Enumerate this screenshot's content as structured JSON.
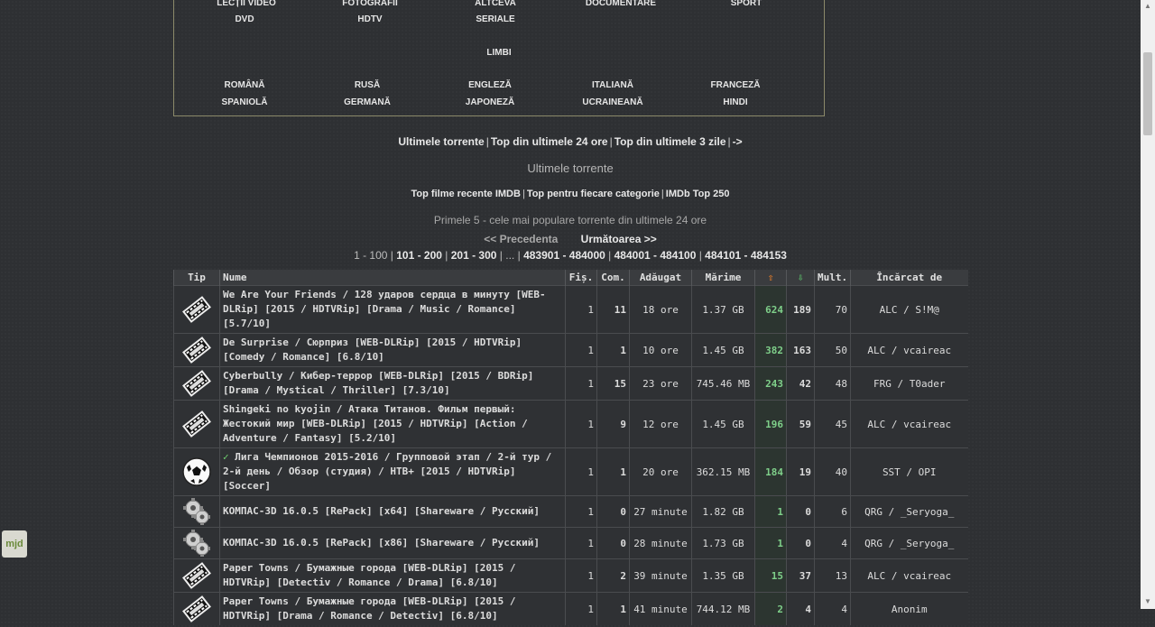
{
  "categories": {
    "row1": [
      "LECȚII VIDEO",
      "FOTOGRAFII",
      "ALTCEVA",
      "DOCUMENTARE",
      "SPORT"
    ],
    "row2": [
      "DVD",
      "HDTV",
      "SERIALE"
    ],
    "limbi_label": "LIMBI",
    "row3": [
      "ROMÂNĂ",
      "RUSĂ",
      "ENGLEZĂ",
      "ITALIANĂ",
      "FRANCEZĂ"
    ],
    "row4": [
      "SPANIOLĂ",
      "GERMANĂ",
      "JAPONEZĂ",
      "UCRAINEANĂ",
      "HINDI"
    ]
  },
  "nav": {
    "links": [
      "Ultimele torrente",
      "Top din ultimele 24 ore",
      "Top din ultimele 3 zile",
      "->"
    ]
  },
  "section_title": "Ultimele torrente",
  "imdb_nav": {
    "links": [
      "Top filme recente IMDB",
      "Top pentru fiecare categorie",
      "IMDb Top 250"
    ]
  },
  "note": "Primele 5 - cele mai populare torrente din ultimele 24 ore",
  "prev_label": "<< Precedenta",
  "next_label": "Următoarea >>",
  "pages": {
    "current": "1 - 100",
    "links": [
      "101 - 200",
      "201 - 300",
      "...",
      "483901 - 484000",
      "484001 - 484100",
      "484101 - 484153"
    ]
  },
  "table": {
    "headers": {
      "tip": "Tip",
      "name": "Nume",
      "files": "Fiș.",
      "comments": "Com.",
      "added": "Adăugat",
      "size": "Mărime",
      "seed_icon": "arrow-up-icon",
      "leech_icon": "arrow-down-icon",
      "mult": "Mult.",
      "uploader": "Încărcat de"
    },
    "rows": [
      {
        "icon": "film-icon",
        "name": "We Are Your Friends / 128 ударов сердца в минуту [WEB-DLRip] [2015 / HDTVRip] [Drama / Music / Romance] [5.7/10]",
        "files": "1",
        "comments": "11",
        "added": "18 ore",
        "size": "1.37 GB",
        "seeders": "624",
        "leechers": "189",
        "mult": "70",
        "uploader": "ALC / S!M@"
      },
      {
        "icon": "film-icon",
        "name": "De Surprise / Сюрприз [WEB-DLRip] [2015 / HDTVRip] [Comedy / Romance] [6.8/10]",
        "files": "1",
        "comments": "1",
        "added": "10 ore",
        "size": "1.45 GB",
        "seeders": "382",
        "leechers": "163",
        "mult": "50",
        "uploader": "ALC / vcaireac"
      },
      {
        "icon": "film-icon",
        "name": "Cyberbully / Кибер-террор [WEB-DLRip] [2015 / BDRip] [Drama / Mystical / Thriller] [7.3/10]",
        "files": "1",
        "comments": "15",
        "added": "23 ore",
        "size": "745.46 MB",
        "seeders": "243",
        "leechers": "42",
        "mult": "48",
        "uploader": "FRG / T0ader"
      },
      {
        "icon": "film-icon",
        "name": "Shingeki no kyojin / Атака Титанов. Фильм первый: Жестокий мир [WEB-DLRip] [2015 / HDTVRip] [Action / Adventure / Fantasy] [5.2/10]",
        "files": "1",
        "comments": "9",
        "added": "12 ore",
        "size": "1.45 GB",
        "seeders": "196",
        "leechers": "59",
        "mult": "45",
        "uploader": "ALC / vcaireac"
      },
      {
        "icon": "soccer-ball-icon",
        "name": "Лига Чемпионов 2015-2016 / Групповой этап / 2-й тур / 2-й день / Обзор (студия) / НТВ+ [2015 / HDTVRip] [Soccer]",
        "files": "1",
        "comments": "1",
        "added": "20 ore",
        "size": "362.15 MB",
        "seeders": "184",
        "leechers": "19",
        "mult": "40",
        "uploader": "SST / OPI"
      },
      {
        "icon": "gears-icon",
        "name": "КОМПАС-3D 16.0.5 [RePack] [x64] [Shareware / Русский]",
        "files": "1",
        "comments": "0",
        "added": "27 minute",
        "size": "1.82 GB",
        "seeders": "1",
        "leechers": "0",
        "mult": "6",
        "uploader": "QRG / _Seryoga_"
      },
      {
        "icon": "gears-icon",
        "name": "КОМПАС-3D 16.0.5 [RePack] [x86] [Shareware / Русский]",
        "files": "1",
        "comments": "0",
        "added": "28 minute",
        "size": "1.73 GB",
        "seeders": "1",
        "leechers": "0",
        "mult": "4",
        "uploader": "QRG / _Seryoga_"
      },
      {
        "icon": "film-icon",
        "name": "Paper Towns / Бумажные города [WEB-DLRip] [2015 / HDTVRip] [Detectiv / Romance / Drama] [6.8/10]",
        "files": "1",
        "comments": "2",
        "added": "39 minute",
        "size": "1.35 GB",
        "seeders": "15",
        "leechers": "37",
        "mult": "13",
        "uploader": "ALC / vcaireac"
      },
      {
        "icon": "film-icon",
        "name": "Paper Towns / Бумажные города [WEB-DLRip] [2015 / HDTVRip] [Drama / Romance / Detectiv] [6.8/10]",
        "files": "1",
        "comments": "1",
        "added": "41 minute",
        "size": "744.12 MB",
        "seeders": "2",
        "leechers": "4",
        "mult": "4",
        "uploader": "Anonim"
      }
    ]
  },
  "side_icon_text": "mjd"
}
